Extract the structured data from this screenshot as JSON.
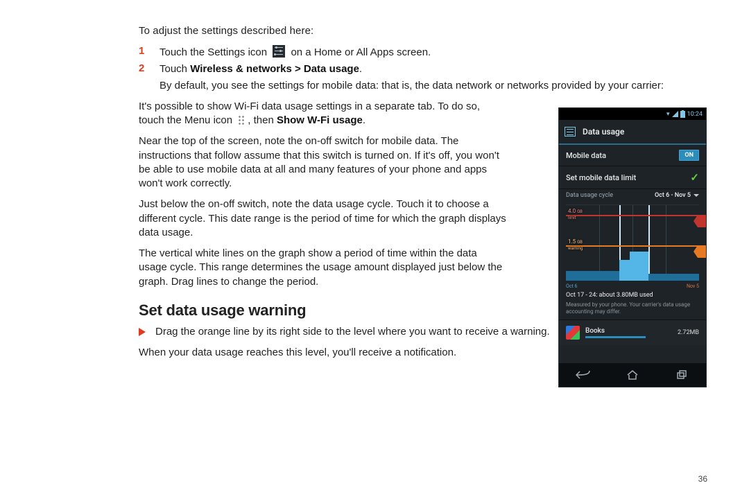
{
  "page": {
    "intro": "To adjust the settings described here:",
    "steps": [
      {
        "num": "1",
        "pre": "Touch the Settings icon",
        "post": " on a Home or All Apps screen."
      },
      {
        "num": "2",
        "pre": "Touch ",
        "bold": "Wireless & networks > Data usage",
        "post": "."
      }
    ],
    "step2_detail": "By default, you see the settings for mobile data: that is, the data network or networks provided by your carrier:",
    "para1_pre": "It's possible to show Wi-Fi data usage settings in a separate tab. To do so, touch the Menu icon",
    "para1_mid": ", then ",
    "para1_bold": "Show W-Fi usage",
    "para1_post": ".",
    "para2": "Near the top of the screen, note the on-off switch for mobile data. The instructions that follow assume that this switch is turned on. If it's off, you won't be able to use mobile data at all and many features of your phone and apps won't work correctly.",
    "para3": "Just below the on-off switch, note the data usage cycle. Touch it to choose a different cycle. This date range is the period of time for which the graph displays data usage.",
    "para4": "The vertical white lines on the graph show a period of time within the data usage cycle. This range determines the usage amount displayed just below the graph. Drag lines to change the period.",
    "heading": "Set data usage warning",
    "bullet": "Drag the orange line by its right side to the level where you want to receive a warning.",
    "closing": "When your data usage reaches this level, you'll receive a notification.",
    "pagenum": "36"
  },
  "phone": {
    "time": "10:24",
    "title": "Data usage",
    "mobile_data_label": "Mobile data",
    "mobile_data_switch": "ON",
    "limit_label": "Set mobile data limit",
    "cycle_label": "Data usage cycle",
    "cycle_value": "Oct 6 - Nov 5",
    "red_value": "4.0",
    "red_unit": "GB",
    "red_sub": "limit",
    "orange_value": "1.5",
    "orange_unit": "GB",
    "orange_sub": "warning",
    "axis_start": "Oct 6",
    "axis_end": "Nov 5",
    "range_text": "Oct 17 - 24: about 3.80MB used",
    "measured_text": "Measured by your phone. Your carrier's data usage accounting may differ.",
    "app_name": "Books",
    "app_size": "2.72MB"
  },
  "chart_data": {
    "type": "area",
    "title": "Data usage",
    "xlabel": "",
    "ylabel": "GB",
    "x_range": [
      "Oct 6",
      "Nov 5"
    ],
    "selected_range": [
      "Oct 17",
      "Oct 24"
    ],
    "limit_line": 4.0,
    "warning_line": 1.5,
    "ylim": [
      0,
      4.5
    ],
    "series": [
      {
        "name": "usage_background",
        "x": [
          "Oct 6",
          "Oct 10",
          "Oct 14",
          "Oct 17",
          "Oct 20",
          "Oct 24",
          "Oct 28",
          "Nov 5"
        ],
        "values": [
          0.05,
          0.08,
          0.18,
          0.22,
          0.8,
          1.05,
          0.6,
          0.05
        ]
      },
      {
        "name": "usage_selected",
        "x": [
          "Oct 17",
          "Oct 20",
          "Oct 24"
        ],
        "values": [
          0.22,
          0.8,
          1.05
        ]
      }
    ],
    "summary_usage": "3.80MB"
  }
}
